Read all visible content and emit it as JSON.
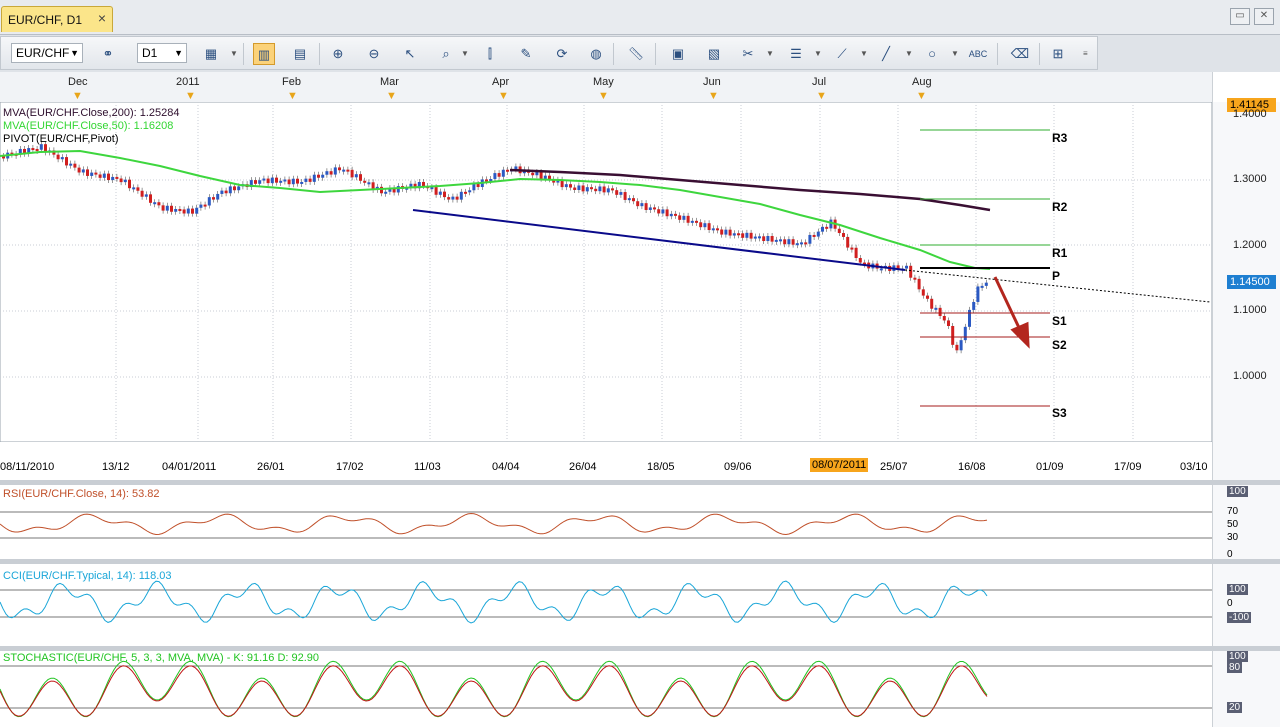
{
  "tab": {
    "title": "EUR/CHF, D1",
    "close": "×"
  },
  "window_buttons": [
    "▭",
    "✕"
  ],
  "toolbar": {
    "symbol": "EUR/CHF",
    "timeframe": "D1",
    "tools": [
      "chart-type",
      "zoom-in",
      "zoom-out",
      "crosshair",
      "magnifier",
      "pointer",
      "line",
      "fibonacci",
      "globe",
      "ruler",
      "image",
      "template",
      "indicators",
      "tools",
      "zoom",
      "brush",
      "ellipse",
      "text",
      "eraser",
      "tree"
    ]
  },
  "price_chart": {
    "month_labels": [
      "Dec",
      "2011",
      "Feb",
      "Mar",
      "Apr",
      "May",
      "Jun",
      "Jul",
      "Aug"
    ],
    "date_labels": [
      "08/11/2010",
      "13/12",
      "04/01/2011",
      "26/01",
      "17/02",
      "11/03",
      "04/04",
      "26/04",
      "18/05",
      "09/06",
      "08/07/2011",
      "25/07",
      "16/08",
      "01/09",
      "17/09",
      "03/10"
    ],
    "highlight_date": "08/07/2011",
    "price_labels": [
      "1.4000",
      "1.3000",
      "1.2000",
      "1.1000",
      "1.0000"
    ],
    "current_price": "1.14500",
    "top_price": "1.41145",
    "indicators": [
      {
        "text": "MVA(EUR/CHF.Close,200): 1.25284",
        "color": "#2e0f2e"
      },
      {
        "text": "MVA(EUR/CHF.Close,50): 1.16208",
        "color": "#33d633"
      },
      {
        "text": "PIVOT(EUR/CHF,Pivot)",
        "color": "#000000"
      }
    ],
    "pivot_levels": [
      "R3",
      "R2",
      "R1",
      "P",
      "S1",
      "S2",
      "S3"
    ]
  },
  "rsi_panel": {
    "label": "RSI(EUR/CHF.Close, 14): 53.82",
    "color": "#c0502a",
    "scale": [
      "100",
      "70",
      "50",
      "30",
      "0"
    ]
  },
  "cci_panel": {
    "label": "CCI(EUR/CHF.Typical, 14): 118.03",
    "color": "#1aa6d8",
    "scale": [
      "100",
      "0",
      "-100"
    ]
  },
  "stoch_panel": {
    "label": "STOCHASTIC(EUR/CHF, 5, 3, 3, MVA, MVA) -  K: 91.16  D: 92.90",
    "scale": [
      "100",
      "80",
      "20"
    ]
  }
}
